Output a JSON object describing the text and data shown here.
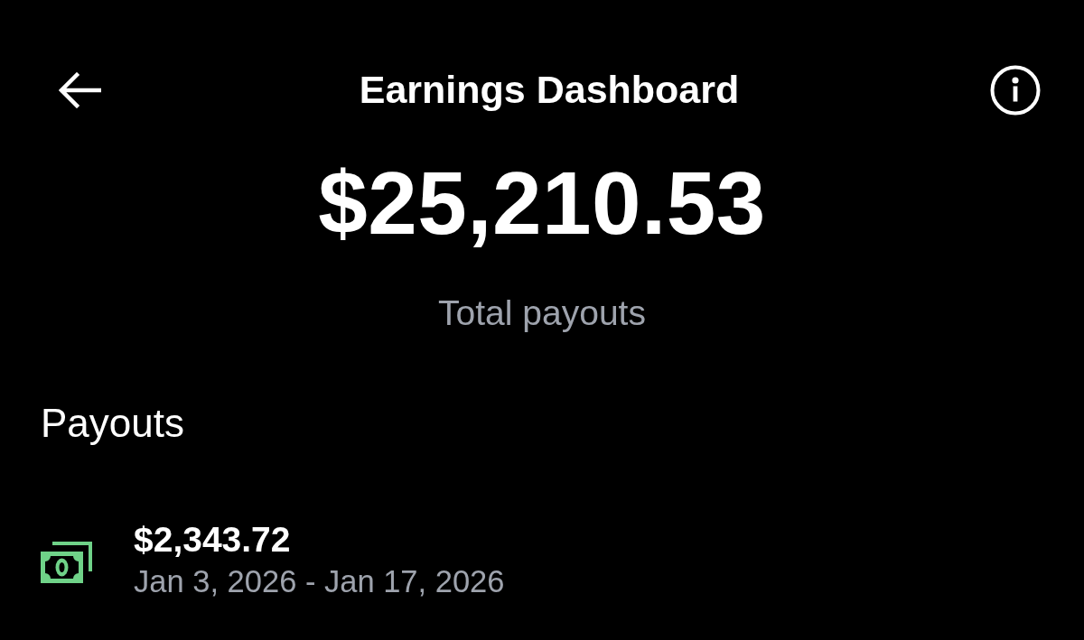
{
  "header": {
    "title": "Earnings Dashboard"
  },
  "summary": {
    "amount": "$25,210.53",
    "label": "Total payouts"
  },
  "payouts": {
    "heading": "Payouts",
    "items": [
      {
        "amount": "$2,343.72",
        "period": "Jan 3, 2026 - Jan 17, 2026"
      }
    ]
  }
}
